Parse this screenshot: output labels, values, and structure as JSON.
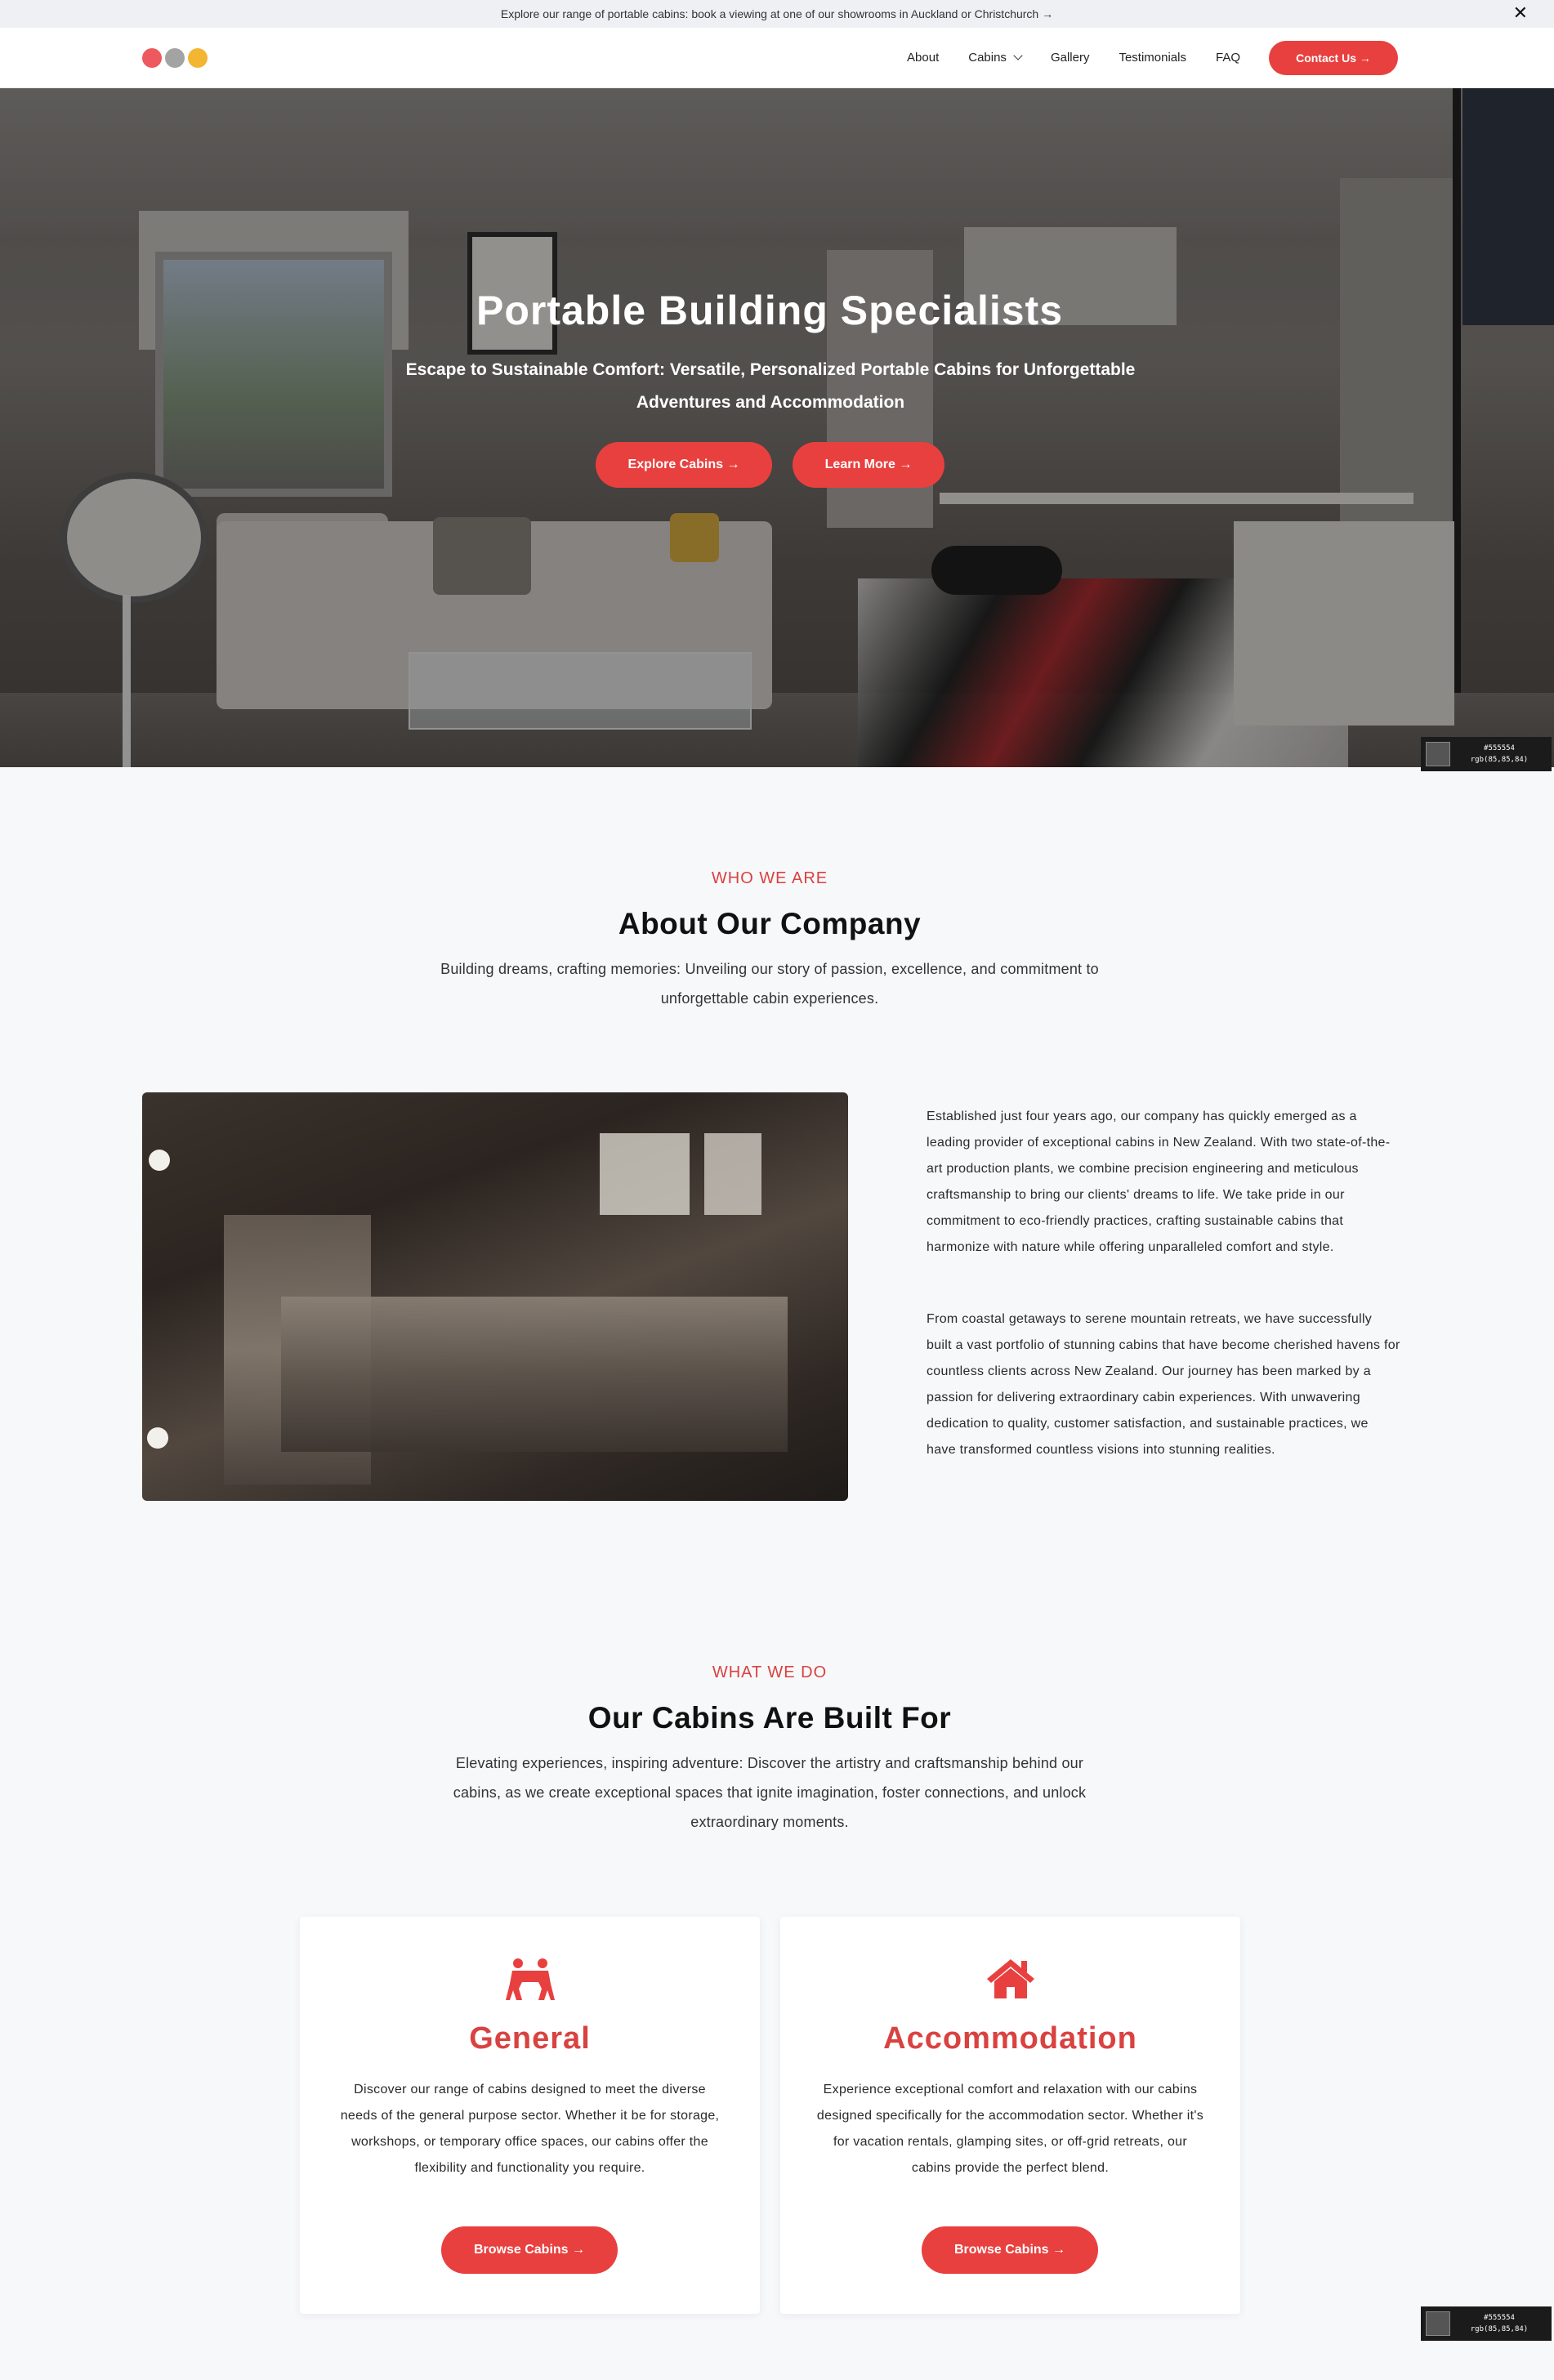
{
  "announcement": {
    "text": "Explore our range of portable cabins: book a viewing at one of our showrooms in Auckland or Christchurch →",
    "close_label": "✕"
  },
  "nav": {
    "logo_colors": [
      "#ec5a5f",
      "#a3a3a3",
      "#f2b632"
    ],
    "links": [
      {
        "label": "About"
      },
      {
        "label": "Cabins"
      },
      {
        "label": "Gallery"
      },
      {
        "label": "Testimonials"
      },
      {
        "label": "FAQ"
      }
    ],
    "contact_label": "Contact Us →"
  },
  "hero": {
    "title": "Portable Building Specialists",
    "subtitle": "Escape to Sustainable Comfort: Versatile, Personalized Portable Cabins for Unforgettable Adventures and Accommodation",
    "primary_button": "Explore Cabins →",
    "secondary_button": "Learn More →"
  },
  "color_swatch": {
    "hex": "#555554",
    "rgb": "rgb(85,85,84)"
  },
  "about": {
    "eyebrow": "WHO WE ARE",
    "title": "About Our Company",
    "description": "Building dreams, crafting memories: Unveiling our story of passion, excellence, and commitment to unforgettable cabin experiences.",
    "paragraphs": [
      "Established just four years ago, our company has quickly emerged as a leading provider of exceptional cabins in New Zealand. With two state-of-the-art production plants, we combine precision engineering and meticulous craftsmanship to bring our clients' dreams to life. We take pride in our commitment to eco-friendly practices, crafting sustainable cabins that harmonize with nature while offering unparalleled comfort and style.",
      "From coastal getaways to serene mountain retreats, we have successfully built a vast portfolio of stunning cabins that have become cherished havens for countless clients across New Zealand. Our journey has been marked by a passion for delivering extraordinary cabin experiences. With unwavering dedication to quality, customer satisfaction, and sustainable practices, we have transformed countless visions into stunning realities."
    ]
  },
  "services": {
    "eyebrow": "WHAT WE DO",
    "title": "Our Cabins Are Built For",
    "description": "Elevating experiences, inspiring adventure: Discover the artistry and craftsmanship behind our cabins, as we create exceptional spaces that ignite imagination, foster connections, and unlock extraordinary moments.",
    "cards": [
      {
        "icon": "people-carry-icon",
        "title": "General",
        "description": "Discover our range of cabins designed to meet the diverse needs of the general purpose sector. Whether it be for storage, workshops, or temporary office spaces, our cabins offer the flexibility and functionality you require.",
        "button": "Browse Cabins →"
      },
      {
        "icon": "house-icon",
        "title": "Accommodation",
        "description": "Experience exceptional comfort and relaxation with our cabins designed specifically for the accommodation sector. Whether it's for vacation rentals, glamping sites, or off-grid retreats, our cabins provide the perfect blend.",
        "button": "Browse Cabins →"
      }
    ]
  },
  "colors": {
    "accent": "#e8403f",
    "eyebrow": "#d94240",
    "background": "#f7f8fa"
  }
}
